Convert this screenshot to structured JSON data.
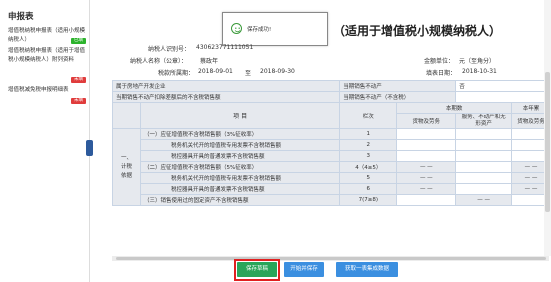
{
  "sidebar": {
    "title": "申报表",
    "items": [
      {
        "label": "增值税纳税申报表（适用小规模纳税人）",
        "badge": "已填",
        "badge_color": "#2db32d"
      },
      {
        "label": "增值税纳税申报表（适用于增值税小规模纳税人）附列资料",
        "badge": "未填",
        "badge_color": "#e03c3c"
      },
      {
        "label": "增值税减免税申报明细表",
        "badge": "未填",
        "badge_color": "#e03c3c"
      }
    ]
  },
  "toast": {
    "icon": "smile-icon",
    "message": "保存成功!"
  },
  "header": {
    "title": "（适用于增值税小规模纳税人）",
    "taxpayer_id_label": "纳税人识别号：",
    "taxpayer_id": "430623771111051",
    "taxpayer_name_label": "纳税人名称（公章）：",
    "taxpayer_name": "蔡政年",
    "period_label": "税款所属期：",
    "period_start": "2018-09-01",
    "period_to": "至",
    "period_end": "2018-09-30",
    "unit_label": "金额单位：",
    "unit": "元（至角分）",
    "fill_date_label": "填表日期：",
    "fill_date": "2018-10-31"
  },
  "table": {
    "real_estate_label": "属于房地产开发企业",
    "current_period_real_estate_label": "当期销售不动产",
    "current_period_real_estate_value": "否",
    "deduction_label": "当期销售不动产扣除差额后的不含税销售额",
    "current_sales_label": "当期销售不动产（不含税）",
    "col_item": "项  目",
    "col_row": "栏次",
    "col_this_period": "本期数",
    "col_this_year": "本年累",
    "sub_goods": "货物及劳务",
    "sub_services": "服务、不动产和无形资产",
    "sub_goods2": "货物及劳务",
    "side_label": "一、计税依据",
    "rows": [
      {
        "label": "（一）应征增值税不含税销售额（3%征收率）",
        "num": "1",
        "v1": "",
        "v2": "",
        "v3": ""
      },
      {
        "label": "税务机关代开的增值税专用发票不含税销售额",
        "num": "2",
        "v1": "",
        "v2": "",
        "v3": ""
      },
      {
        "label": "税控器具开具的普通发票不含税销售额",
        "num": "3",
        "v1": "",
        "v2": "",
        "v3": ""
      },
      {
        "label": "（二）应征增值税不含税销售额（5%征收率）",
        "num": "4（4≥5）",
        "v1": "— —",
        "v2": "",
        "v3": "— —"
      },
      {
        "label": "税务机关代开的增值税专用发票不含税销售额",
        "num": "5",
        "v1": "— —",
        "v2": "",
        "v3": "— —"
      },
      {
        "label": "税控器具开具的普通发票不含税销售额",
        "num": "6",
        "v1": "— —",
        "v2": "",
        "v3": "— —"
      },
      {
        "label": "（三）销售使用过的固定资产不含税销售额",
        "num": "7(7≥8)",
        "v1": "",
        "v2": "— —",
        "v3": ""
      }
    ]
  },
  "buttons": {
    "save_draft": "保存草稿",
    "save_start": "开始并保存",
    "fetch_data": "获取一表集成数据"
  }
}
